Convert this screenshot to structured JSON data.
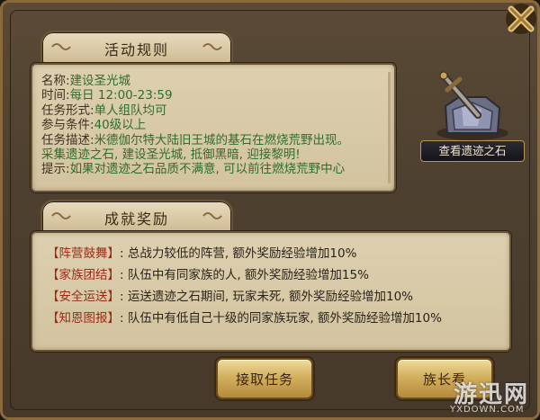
{
  "rules": {
    "title": "活动规则",
    "lines": [
      {
        "key": "名称:",
        "value": "建设圣光城"
      },
      {
        "key": "时间:",
        "value": "每日 12:00-23:59"
      },
      {
        "key": "任务形式:",
        "value": "单人组队均可"
      },
      {
        "key": "参与条件:",
        "value": "40级以上"
      },
      {
        "key": "任务描述:",
        "value": "米德伽尔特大陆旧王城的基石在燃烧荒野出现。"
      },
      {
        "key": "",
        "value": "采集遗迹之石, 建设圣光城, 抵御黑暗, 迎接黎明!"
      },
      {
        "key": "提示:",
        "value": "如果对遗迹之石品质不满意, 可以前往燃烧荒野中心"
      }
    ]
  },
  "chest": {
    "label": "查看遗迹之石",
    "icon": "relic-stone-chest-icon"
  },
  "rewards": {
    "title": "成就奖励",
    "items": [
      {
        "name": "阵营鼓舞",
        "desc": "总战力较低的阵营, 额外奖励经验增加10%"
      },
      {
        "name": "家族团结",
        "desc": "队伍中有同家族的人, 额外奖励经验增加15%"
      },
      {
        "name": "安全运送",
        "desc": "运送遗迹之石期间, 玩家未死, 额外奖励经验增加10%"
      },
      {
        "name": "知恩图报",
        "desc": "队伍中有低自己十级的同家族玩家, 额外奖励经验增加10%"
      }
    ]
  },
  "buttons": {
    "accept": "接取任务",
    "leader": "族长看"
  },
  "watermark": {
    "big": "游迅网",
    "small": "YXDOWN.COM"
  },
  "colors": {
    "value_green": "#2f6d2a",
    "reward_red": "#9b2a18",
    "button_gold": "#d3b05f"
  }
}
